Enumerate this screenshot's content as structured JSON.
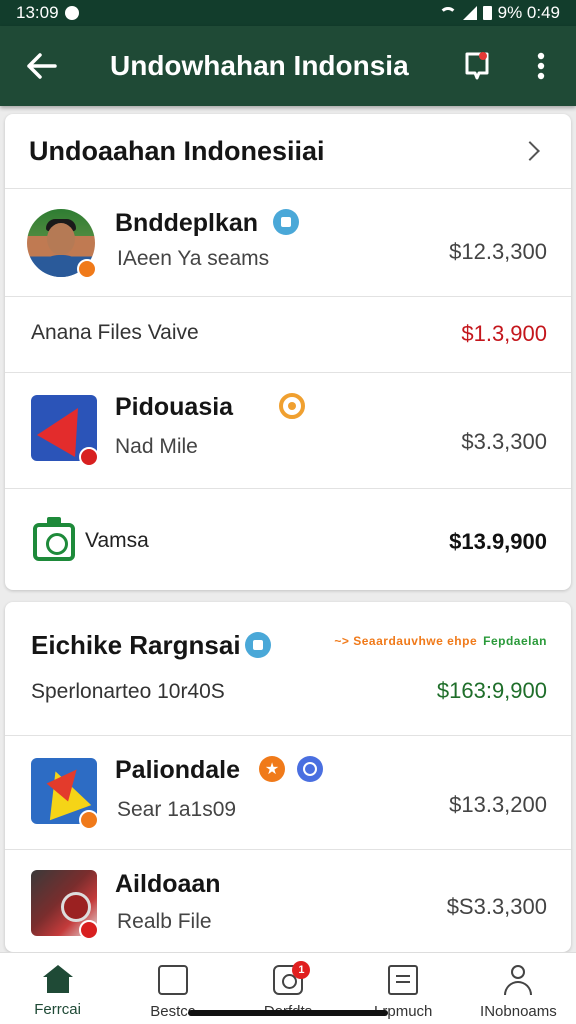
{
  "status_bar": {
    "time": "13:09",
    "battery_text": "9% 0:49"
  },
  "app_bar": {
    "title": "Undowhahan Indonsia"
  },
  "card1": {
    "title": "Undoaahan Indonesiiai",
    "rows": [
      {
        "title": "Bnddeplkan",
        "subtitle": "IAeen Ya seams",
        "value": "$12.3,300"
      },
      {
        "subtitle": "Anana Files Vaive",
        "value": "$1.3,900",
        "value_color": "#c4161c"
      },
      {
        "title": "Pidouasia",
        "subtitle": "Nad Mile",
        "value": "$3.3,300"
      },
      {
        "subtitle": "Vamsa",
        "value": "$13.9,900"
      }
    ]
  },
  "card2": {
    "title": "Eichike Rargnsai",
    "promo": {
      "part1": "~> Seaardauvhwe ehpe",
      "part2": "Fepdaelan"
    },
    "rows": [
      {
        "subtitle": "Sperlonarteo 10r40S",
        "value": "$163:9,900",
        "value_color": "#1f6e2a"
      },
      {
        "title": "Paliondale",
        "subtitle": "Sear 1a1s09",
        "value": "$13.3,200"
      },
      {
        "title": "Aildoaan",
        "subtitle": "Realb File",
        "value": "$S3.3,300"
      }
    ]
  },
  "bottom_nav": [
    {
      "label": "Ferrcai",
      "icon": "home-icon",
      "active": true
    },
    {
      "label": "Bestcc",
      "icon": "box-icon"
    },
    {
      "label": "Dorfdts",
      "icon": "camera-icon",
      "badge": "1"
    },
    {
      "label": "Lrpmuch",
      "icon": "document-icon"
    },
    {
      "label": "INobnoams",
      "icon": "user-icon"
    }
  ]
}
